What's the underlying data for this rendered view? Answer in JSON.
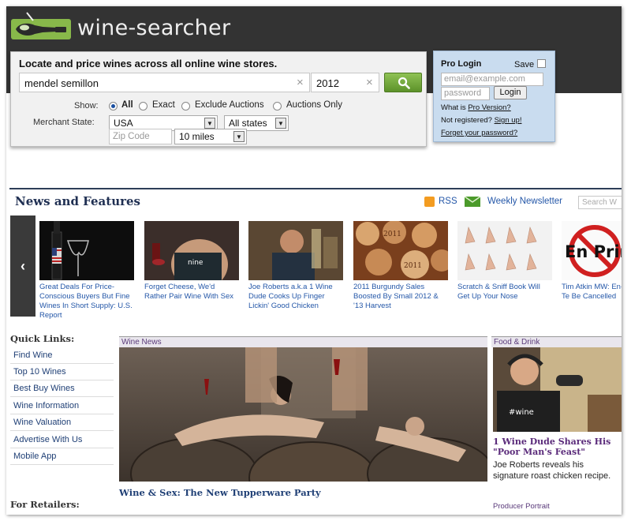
{
  "brand": {
    "name": "wine-searcher"
  },
  "search": {
    "title": "Locate and price wines across all online wine stores.",
    "wine_value": "mendel semillon",
    "year_value": "2012",
    "show_label": "Show:",
    "options": [
      "All",
      "Exact",
      "Exclude Auctions",
      "Auctions Only"
    ],
    "selected_option": "All",
    "merchant_label": "Merchant State:",
    "country": "USA",
    "state": "All states",
    "zip_placeholder": "Zip Code",
    "distance": "10 miles"
  },
  "pro_login": {
    "title": "Pro Login",
    "save_label": "Save",
    "email_placeholder": "email@example.com",
    "password_placeholder": "password",
    "login_label": "Login",
    "what_prefix": "What is ",
    "what_link": "Pro Version?",
    "not_registered_prefix": "Not registered? ",
    "signup_link": "Sign up!",
    "forgot_link": "Forget your password?"
  },
  "news": {
    "title": "News and Features",
    "rss_label": "RSS",
    "newsletter_label": "Weekly Newsletter",
    "search_placeholder": "Search W",
    "prev_label": "‹",
    "items": [
      {
        "caption": "Great Deals For Price-Conscious Buyers But Fine Wines In Short Supply: U.S. Report"
      },
      {
        "caption": "Forget Cheese, We'd Rather Pair Wine With Sex"
      },
      {
        "caption": "Joe Roberts a.k.a 1 Wine Dude Cooks Up Finger Lickin' Good Chicken"
      },
      {
        "caption": "2011 Burgundy Sales Boosted By Small 2012 & '13 Harvest"
      },
      {
        "caption": "Scratch & Sniff Book Will Get Up Your Nose"
      },
      {
        "caption": "Tim Atkin MW: En-Primeur Te Be Cancelled"
      }
    ]
  },
  "thumb_text": {
    "corks_a": "2011",
    "corks_b": "2011",
    "sign": "En Prim"
  },
  "quick_links": {
    "title": "Quick Links:",
    "items": [
      "Find Wine",
      "Top 10 Wines",
      "Best Buy Wines",
      "Wine Information",
      "Wine Valuation",
      "Advertise With Us",
      "Mobile App"
    ],
    "retailers_title": "For Retailers:"
  },
  "main_story": {
    "tab": "Wine News",
    "headline": "Wine & Sex: The New Tupperware Party"
  },
  "food_drink": {
    "tab": "Food & Drink",
    "headline": "1 Wine Dude Shares His \"Poor Man's Feast\"",
    "summary": "Joe Roberts reveals his signature roast chicken recipe.",
    "next_label": "Producer Portrait"
  },
  "colors": {
    "topbar": "#333333",
    "link": "#2457a8",
    "go_button": "#6fa43a",
    "pro_panel": "#c9dcef",
    "heading": "#1f2f52"
  },
  "icons": [
    "bottle-logo-icon",
    "search-icon",
    "clear-x-icon",
    "rss-icon",
    "newsletter-envelope-icon",
    "chevron-left-icon",
    "dropdown-arrow-icon"
  ]
}
